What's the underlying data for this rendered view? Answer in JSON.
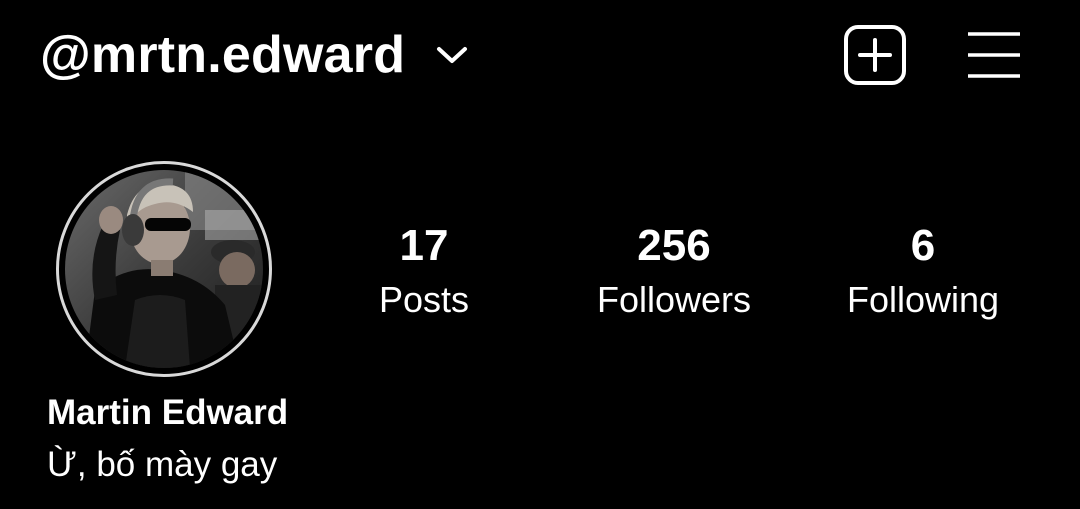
{
  "header": {
    "username": "@mrtn.edward",
    "switch_icon": "chevron-down-icon",
    "create_icon": "plus-square-icon",
    "menu_icon": "hamburger-menu-icon"
  },
  "profile": {
    "display_name": "Martin Edward",
    "bio": "Ừ, bố mày gay",
    "avatar_ring_color": "#d9d9d9"
  },
  "stats": {
    "posts": {
      "value": "17",
      "label": "Posts"
    },
    "followers": {
      "value": "256",
      "label": "Followers"
    },
    "following": {
      "value": "6",
      "label": "Following"
    }
  },
  "theme": {
    "background": "#000000",
    "text": "#ffffff"
  }
}
